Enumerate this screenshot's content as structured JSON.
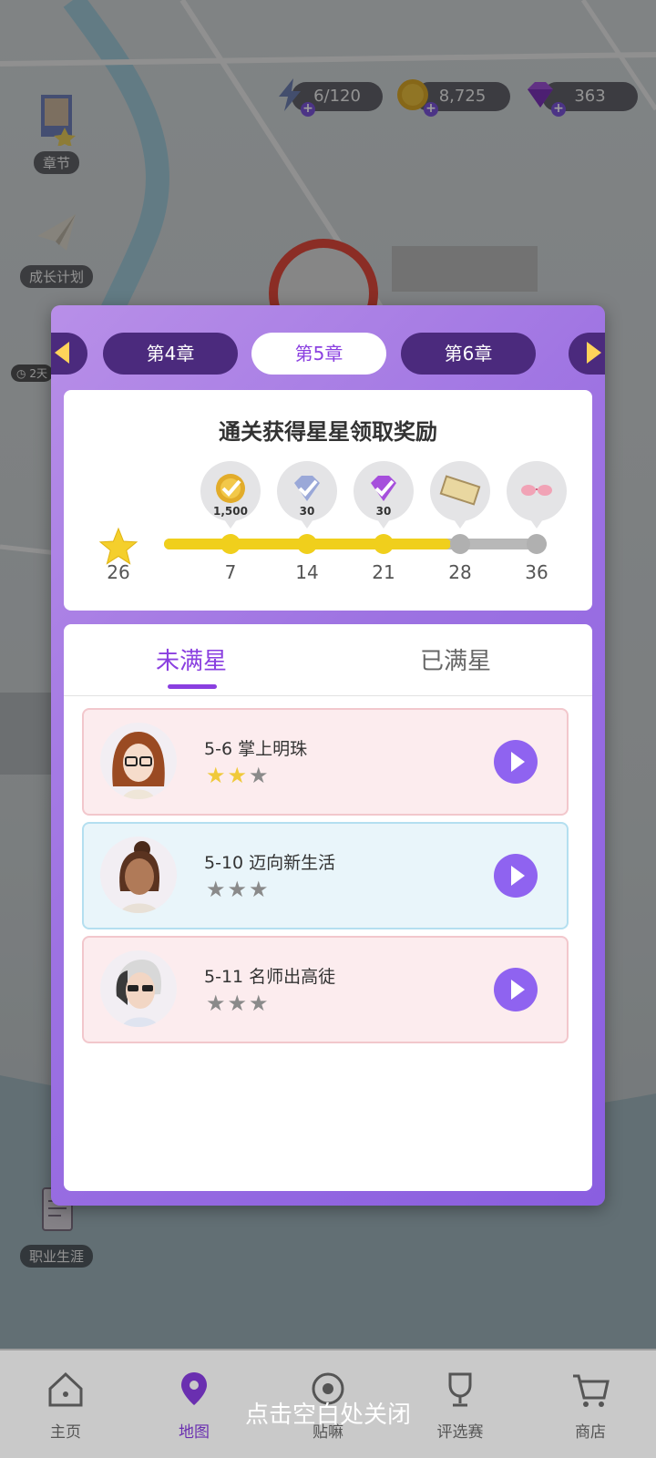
{
  "resources": {
    "energy": "6/120",
    "coins": "8,725",
    "gems": "363"
  },
  "side_buttons": {
    "chapter": "章节",
    "growth_plan": "成长计划",
    "career": "职业生涯",
    "timer_fragment": "2天"
  },
  "chapters": {
    "prev": "第4章",
    "current": "第5章",
    "next": "第6章"
  },
  "rewards": {
    "title": "通关获得星星领取奖励",
    "current_stars": "26",
    "items": [
      {
        "icon": "coin-reward-icon",
        "amount": "1,500",
        "threshold": "7"
      },
      {
        "icon": "diamond-reward-icon",
        "amount": "30",
        "threshold": "14"
      },
      {
        "icon": "gem-reward-icon",
        "amount": "30",
        "threshold": "21"
      },
      {
        "icon": "ticket-reward-icon",
        "amount": "",
        "threshold": "28"
      },
      {
        "icon": "sunglasses-reward-icon",
        "amount": "",
        "threshold": "36"
      }
    ],
    "progress_fraction": 0.75
  },
  "list_tabs": {
    "unfull": "未满星",
    "full": "已满星"
  },
  "levels": [
    {
      "title": "5-6 掌上明珠",
      "stars": 2,
      "style": "pink"
    },
    {
      "title": "5-10 迈向新生活",
      "stars": 0,
      "style": "blue"
    },
    {
      "title": "5-11 名师出高徒",
      "stars": 0,
      "style": "pink"
    }
  ],
  "bottom_nav": {
    "home": "主页",
    "map": "地图",
    "tieba": "贴嘛",
    "contest": "评选赛",
    "shop": "商店"
  },
  "hint": "点击空白处关闭",
  "colors": {
    "accent": "#8a3fe0",
    "star_gold": "#f0c93a",
    "progress": "#f0cf1c"
  }
}
